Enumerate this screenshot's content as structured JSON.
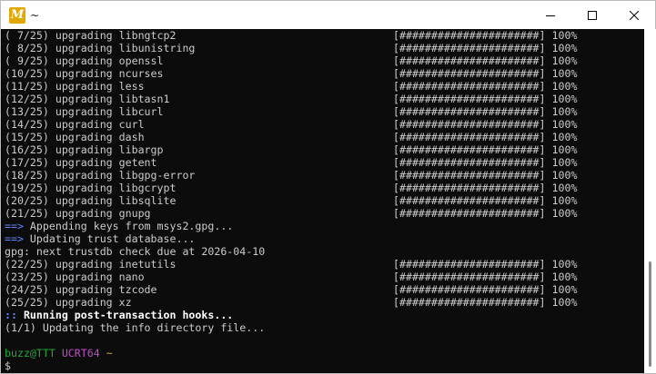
{
  "window": {
    "title": "~",
    "app_icon_letter": "M",
    "controls": [
      "minimize-icon",
      "maximize-icon",
      "close-icon"
    ]
  },
  "terminal": {
    "upgrade_lines": [
      {
        "text": "( 7/25) upgrading libngtcp2",
        "bar": "[######################] 100%"
      },
      {
        "text": "( 8/25) upgrading libunistring",
        "bar": "[######################] 100%"
      },
      {
        "text": "( 9/25) upgrading openssl",
        "bar": "[######################] 100%"
      },
      {
        "text": "(10/25) upgrading ncurses",
        "bar": "[######################] 100%"
      },
      {
        "text": "(11/25) upgrading less",
        "bar": "[######################] 100%"
      },
      {
        "text": "(12/25) upgrading libtasn1",
        "bar": "[######################] 100%"
      },
      {
        "text": "(13/25) upgrading libcurl",
        "bar": "[######################] 100%"
      },
      {
        "text": "(14/25) upgrading curl",
        "bar": "[######################] 100%"
      },
      {
        "text": "(15/25) upgrading dash",
        "bar": "[######################] 100%"
      },
      {
        "text": "(16/25) upgrading libargp",
        "bar": "[######################] 100%"
      },
      {
        "text": "(17/25) upgrading getent",
        "bar": "[######################] 100%"
      },
      {
        "text": "(18/25) upgrading libgpg-error",
        "bar": "[######################] 100%"
      },
      {
        "text": "(19/25) upgrading libgcrypt",
        "bar": "[######################] 100%"
      },
      {
        "text": "(20/25) upgrading libsqlite",
        "bar": "[######################] 100%"
      },
      {
        "text": "(21/25) upgrading gnupg",
        "bar": "[######################] 100%"
      }
    ],
    "arrow1": "==>",
    "msg1": " Appending keys from msys2.gpg...",
    "arrow2": "==>",
    "msg2": " Updating trust database...",
    "gpg_line": "gpg: next trustdb check due at 2026-04-10",
    "upgrade_lines_2": [
      {
        "text": "(22/25) upgrading inetutils",
        "bar": "[######################] 100%"
      },
      {
        "text": "(23/25) upgrading nano",
        "bar": "[######################] 100%"
      },
      {
        "text": "(24/25) upgrading tzcode",
        "bar": "[######################] 100%"
      },
      {
        "text": "(25/25) upgrading xz",
        "bar": "[######################] 100%"
      }
    ],
    "hooks_prefix": "::",
    "hooks_text": " Running post-transaction hooks...",
    "info_line": "(1/1) Updating the info directory file...",
    "prompt_user": "buzz@TTT",
    "prompt_shell": "UCRT64",
    "prompt_dir": "~",
    "prompt_symbol": "$"
  }
}
